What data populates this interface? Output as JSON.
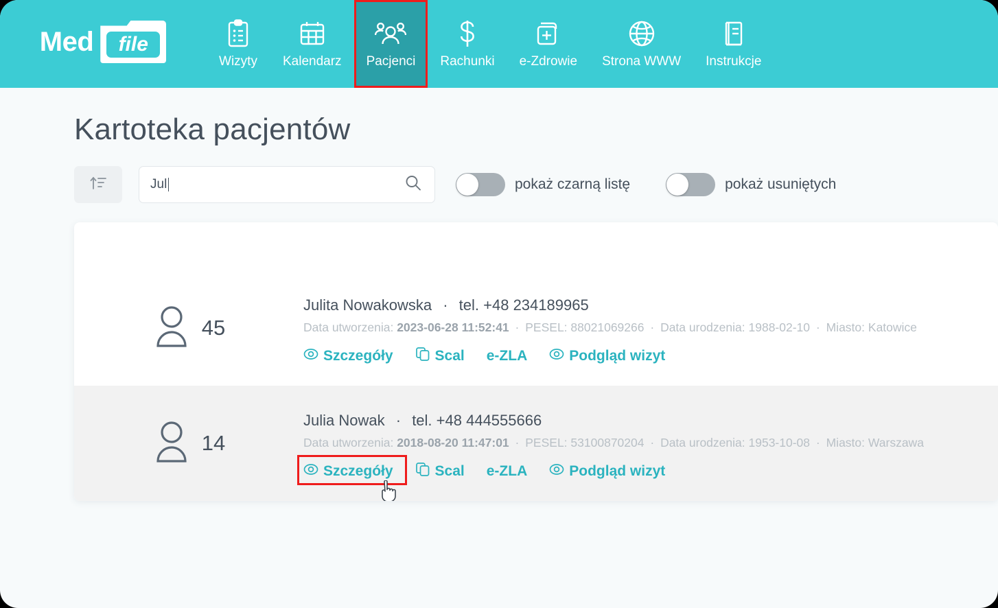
{
  "brand": {
    "name_part1": "Med",
    "name_part2": "file"
  },
  "nav": {
    "items": [
      {
        "label": "Wizyty",
        "icon": "clipboard-icon",
        "active": false
      },
      {
        "label": "Kalendarz",
        "icon": "calendar-icon",
        "active": false
      },
      {
        "label": "Pacjenci",
        "icon": "patients-icon",
        "active": true
      },
      {
        "label": "Rachunki",
        "icon": "dollar-icon",
        "active": false
      },
      {
        "label": "e-Zdrowie",
        "icon": "health-document-icon",
        "active": false
      },
      {
        "label": "Strona WWW",
        "icon": "globe-icon",
        "active": false
      },
      {
        "label": "Instrukcje",
        "icon": "book-icon",
        "active": false
      }
    ]
  },
  "page": {
    "title": "Kartoteka pacjentów"
  },
  "toolbar": {
    "sort_icon": "sort-ascending-icon",
    "search": {
      "value": "Jul",
      "placeholder": "",
      "icon": "search-icon"
    },
    "toggles": [
      {
        "label": "pokaż czarną listę",
        "on": false
      },
      {
        "label": "pokaż usuniętych",
        "on": false
      }
    ]
  },
  "labels": {
    "tel": "tel.",
    "created": "Data utworzenia:",
    "pesel": "PESEL:",
    "birth": "Data urodzenia:",
    "city": "Miasto:",
    "separator": "·"
  },
  "actions": {
    "details": "Szczegóły",
    "merge": "Scal",
    "ezla": "e-ZLA",
    "visits": "Podgląd wizyt"
  },
  "patients": [
    {
      "count": "45",
      "name": "Julita Nowakowska",
      "phone": "+48 234189965",
      "created": "2023-06-28 11:52:41",
      "pesel": "88021069266",
      "birth": "1988-02-10",
      "city": "Katowice"
    },
    {
      "count": "14",
      "name": "Julia Nowak",
      "phone": "+48 444555666",
      "created": "2018-08-20 11:47:01",
      "pesel": "53100870204",
      "birth": "1953-10-08",
      "city": "Warszawa"
    }
  ],
  "colors": {
    "header_teal": "#3cccd4",
    "active_teal": "#2ba0a8",
    "link_teal": "#2bb3bf",
    "highlight_red": "#ef1c1c",
    "text_dark": "#45505c",
    "meta_gray": "#b9c0c6",
    "page_bg": "#f7fafb",
    "row_alt_bg": "#f2f2f2"
  },
  "highlights": [
    {
      "target": "nav-item-pacjenci"
    },
    {
      "target": "row-2-details-action"
    }
  ]
}
